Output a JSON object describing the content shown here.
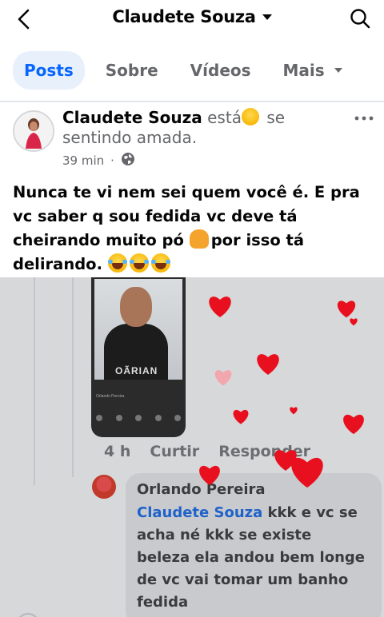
{
  "header": {
    "title": "Claudete Souza"
  },
  "tabs": [
    {
      "label": "Posts",
      "active": true
    },
    {
      "label": "Sobre",
      "active": false
    },
    {
      "label": "Vídeos",
      "active": false
    },
    {
      "label": "Mais",
      "active": false
    }
  ],
  "post": {
    "author": "Claudete Souza",
    "feeling_prefix": "está",
    "feeling_suffix": "se sentindo amada.",
    "time": "39 min",
    "audience_icon": "globe-icon",
    "text_line1": "Nunca te vi nem sei quem você é. E pra vc saber q sou fedida vc deve tá cheirando muito pó",
    "text_line2": "por isso tá delirando."
  },
  "shared_image": {
    "photo_shirt_text": "OÃRIAN",
    "photo_caption_name": "Orlando Pereira",
    "comment_time": "4 h",
    "like_label": "Curtir",
    "reply_label": "Responder",
    "comment": {
      "author": "Orlando Pereira",
      "mention": "Claudete Souza",
      "text": " kkk e vc se acha né kkk se existe beleza ela andou bem longe de vc  vai tomar um banho fedida"
    }
  },
  "colors": {
    "accent": "#0866ff",
    "tab_active_bg": "#e7f0fb",
    "muted": "#65676b",
    "heart": "#e8101e"
  }
}
